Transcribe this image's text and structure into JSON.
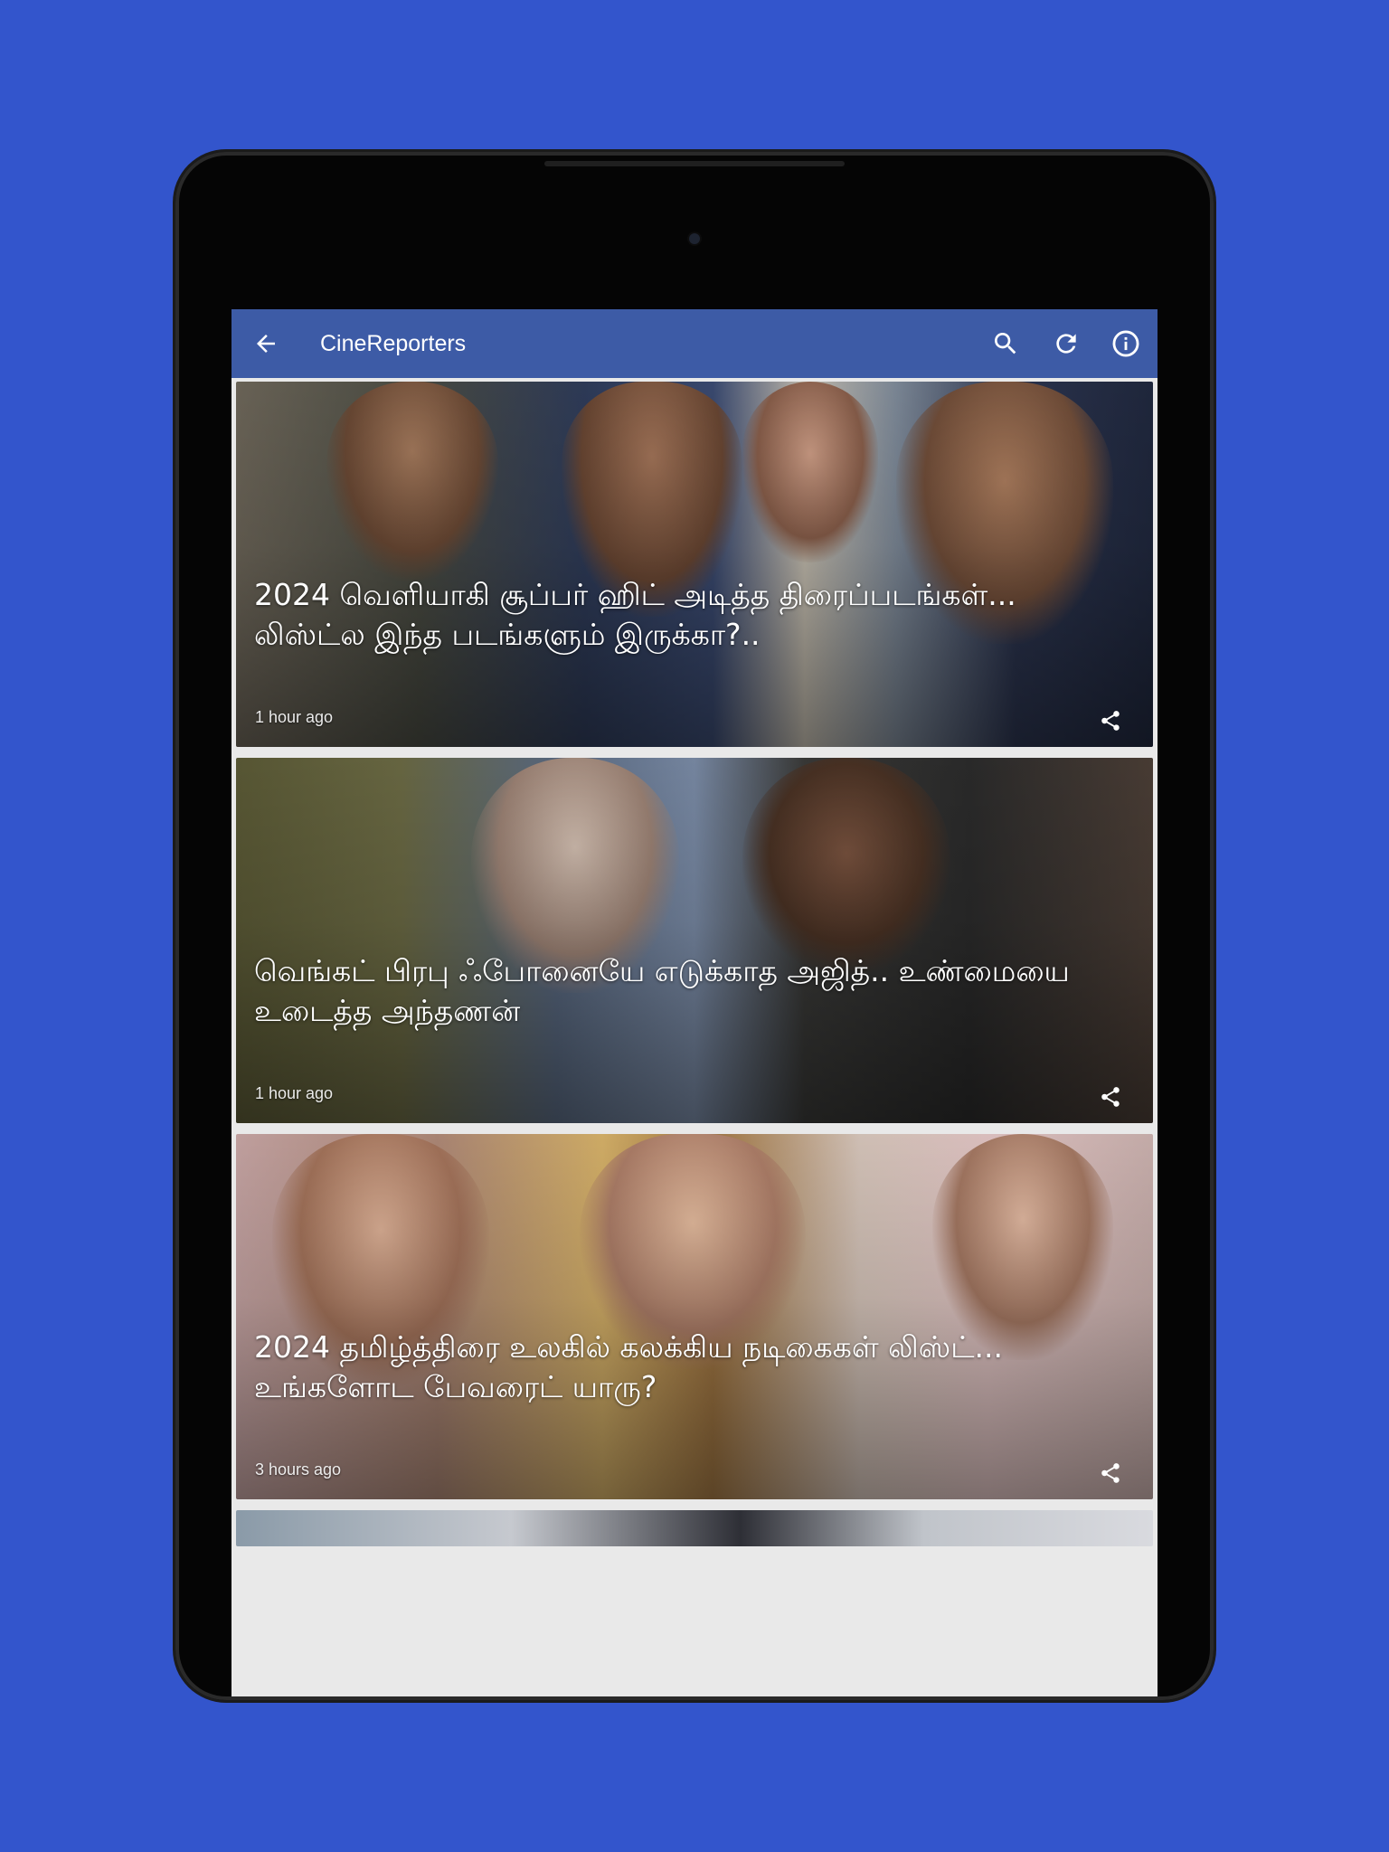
{
  "appbar": {
    "title": "CineReporters",
    "back_icon": "arrow-left-icon",
    "actions": [
      "search-icon",
      "refresh-icon",
      "info-icon"
    ],
    "color": "#3d5ba6"
  },
  "articles": [
    {
      "headline": "2024 வெளியாகி சூப்பர் ஹிட் அடித்த திரைப்படங்கள்... லிஸ்ட்ல இந்த படங்களும் இருக்கா?..",
      "time": "1 hour ago"
    },
    {
      "headline": "வெங்கட் பிரபு ஃபோனையே எடுக்காத அஜித்.. உண்மையை உடைத்த அந்தணன்",
      "time": "1 hour ago"
    },
    {
      "headline": "2024 தமிழ்த்திரை உலகில் கலக்கிய நடிகைகள் லிஸ்ட்... உங்களோட பேவரைட் யாரு?",
      "time": "3 hours ago"
    }
  ],
  "colors": {
    "background": "#3355cc",
    "device": "#050505"
  }
}
